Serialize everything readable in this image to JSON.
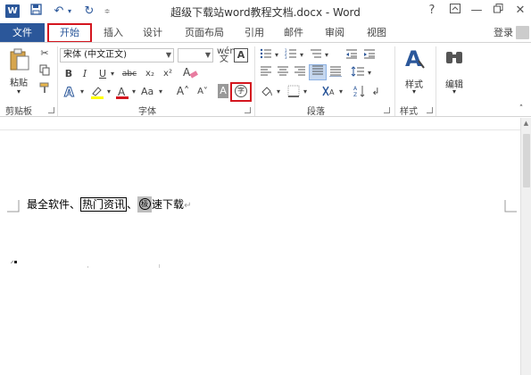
{
  "titlebar": {
    "logo": "W",
    "title": "超级下载站word教程文档.docx - Word",
    "help": "?",
    "minimize": "—",
    "close": "✕"
  },
  "tabs": {
    "file": "文件",
    "home": "开始",
    "insert": "插入",
    "design": "设计",
    "layout": "页面布局",
    "references": "引用",
    "mailings": "邮件",
    "review": "审阅",
    "view": "视图",
    "login": "登录"
  },
  "ribbon": {
    "paste_label": "粘贴",
    "clipboard_label": "剪贴板",
    "font_name": "宋体 (中文正文)",
    "font_label": "字体",
    "paragraph_label": "段落",
    "styles_label": "样式",
    "styles_button": "样式",
    "edit_button": "编辑",
    "bold": "B",
    "italic": "I",
    "underline": "U",
    "strike": "abc",
    "subscript": "x₂",
    "superscript": "x²",
    "grow": "A˄",
    "shrink": "A˅",
    "phonetic": "A",
    "enclosed_char": "字"
  },
  "document": {
    "text_before": "最全软件、",
    "boxed_text": "热门资讯",
    "sep": "、",
    "enclosed_char": "极",
    "text_after": "速下载",
    "pilcrow": "↵"
  },
  "colors": {
    "accent": "#2b579a",
    "highlight_red": "#d4161f"
  }
}
